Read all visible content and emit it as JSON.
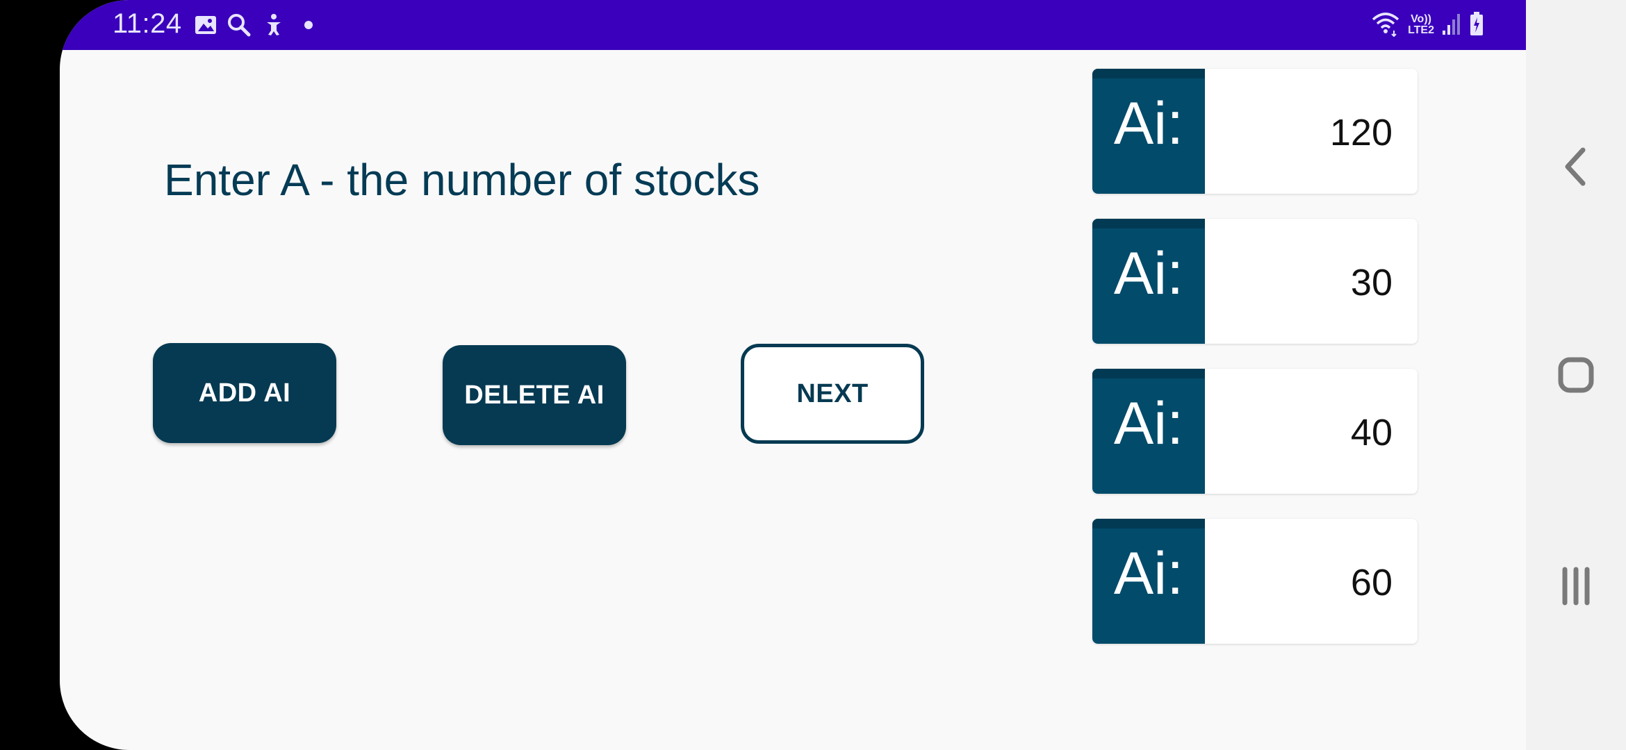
{
  "status_bar": {
    "time": "11:24",
    "left_icons": [
      "image-icon",
      "search-icon",
      "accessibility-icon",
      "dot-icon"
    ],
    "lte_line1": "Vo))",
    "lte_line2": "LTE2",
    "right_icons": [
      "wifi-icon",
      "signal-icon",
      "battery-icon"
    ],
    "background": "#3a00bc"
  },
  "main": {
    "prompt": "Enter A - the number of stocks",
    "buttons": {
      "add": "ADD AI",
      "delete": "DELETE AI",
      "next": "NEXT"
    }
  },
  "ai_list": [
    {
      "label": "Ai:",
      "value": "120"
    },
    {
      "label": "Ai:",
      "value": "30"
    },
    {
      "label": "Ai:",
      "value": "40"
    },
    {
      "label": "Ai:",
      "value": "60"
    }
  ],
  "nav_bar": {
    "buttons": [
      "back-icon",
      "home-icon",
      "recents-icon"
    ]
  },
  "colors": {
    "primary": "#063a52",
    "card_label": "#024b6b",
    "background": "#f9f9f9"
  }
}
